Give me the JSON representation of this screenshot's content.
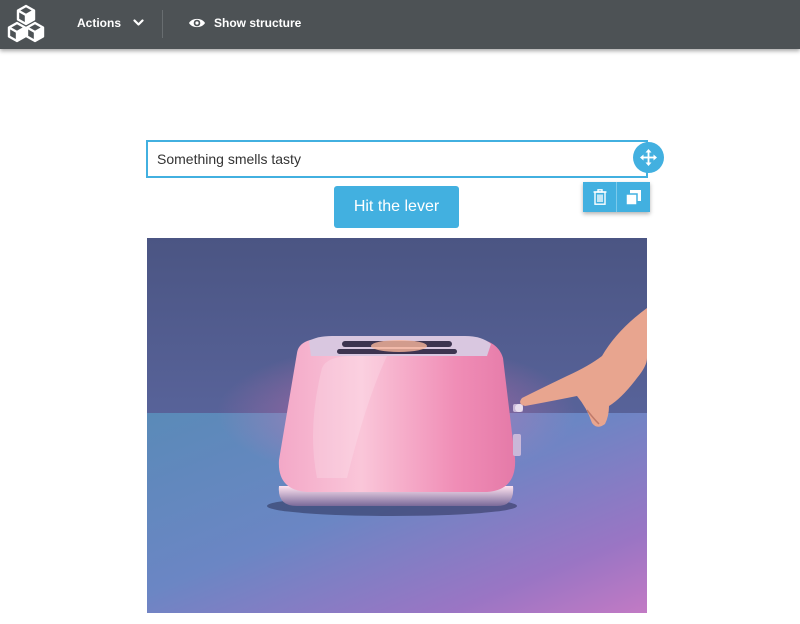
{
  "toolbar": {
    "actions_label": "Actions",
    "show_structure_label": "Show structure",
    "logo_icon": "cubes-logo-icon",
    "chevron_icon": "chevron-down-icon",
    "eye_icon": "eye-icon"
  },
  "editor": {
    "text_value": "Something smells tasty",
    "button_label": "Hit the lever",
    "move_icon": "move-arrows-icon",
    "delete_icon": "trash-icon",
    "duplicate_icon": "duplicate-icon",
    "image_description_icon": "image"
  },
  "colors": {
    "topbar": "#4d5255",
    "accent": "#42b0e0"
  }
}
